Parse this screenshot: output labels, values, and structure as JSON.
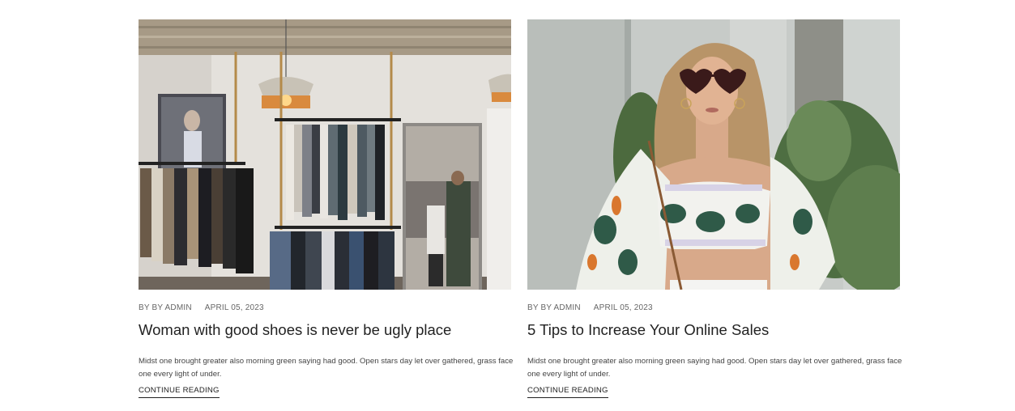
{
  "posts": [
    {
      "author": "BY BY ADMIN",
      "date": "APRIL 05, 2023",
      "title": "Woman with good shoes is never be ugly place",
      "excerpt": "Midst one brought greater also morning green saying had good. Open stars day let over gathered, grass face one every light of under.",
      "read_more": "CONTINUE READING"
    },
    {
      "author": "BY BY ADMIN",
      "date": "APRIL 05, 2023",
      "title": "5 Tips to Increase Your Online Sales",
      "excerpt": "Midst one brought greater also morning green saying had good. Open stars day let over gathered, grass face one every light of under.",
      "read_more": "CONTINUE READING"
    }
  ]
}
